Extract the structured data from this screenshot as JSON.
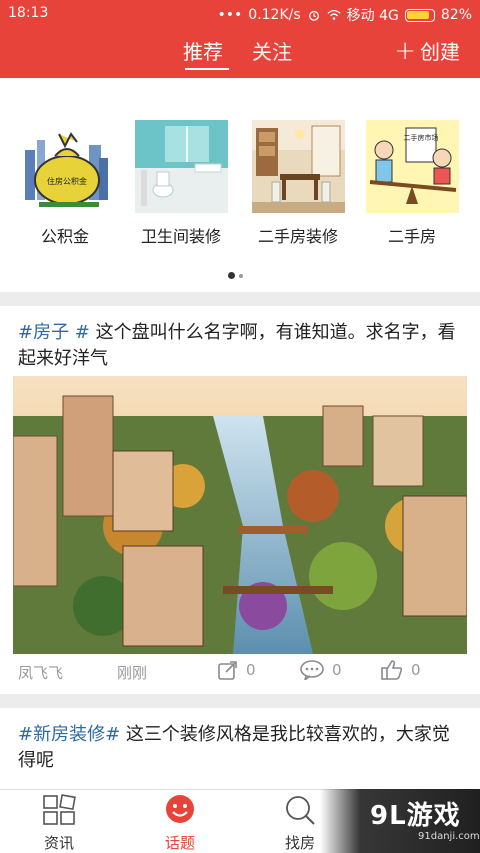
{
  "status": {
    "time": "18:13",
    "net_speed": "0.12K/s",
    "carrier": "移动 4G",
    "battery": "82%"
  },
  "header": {
    "tab_recommend": "推荐",
    "tab_follow": "关注",
    "create_label": "创建",
    "accent": "#e8433b"
  },
  "categories": [
    {
      "label": "公积金",
      "icon": "money-bag-image",
      "bag_text": "住房公积金"
    },
    {
      "label": "卫生间装修",
      "icon": "bathroom-image"
    },
    {
      "label": "二手房装修",
      "icon": "dining-room-image"
    },
    {
      "label": "二手房",
      "icon": "cartoon-seesaw-image",
      "board_text": "二手房市场"
    }
  ],
  "posts": [
    {
      "tag": "#房子 #",
      "text": "这个盘叫什么名字啊，有谁知道。求名字，看起来好洋气",
      "author": "凤飞飞",
      "time": "刚刚",
      "shares": "0",
      "comments": "0",
      "likes": "0"
    },
    {
      "tag": "#新房装修#",
      "text": "这三个装修风格是我比较喜欢的，大家觉得呢"
    }
  ],
  "bottom_nav": [
    {
      "label": "资讯",
      "icon": "grid-icon"
    },
    {
      "label": "话题",
      "icon": "chat-bubble-icon"
    },
    {
      "label": "找房",
      "icon": "search-icon"
    }
  ],
  "watermark": {
    "brand": "9L游戏",
    "url": "91danji.com"
  }
}
